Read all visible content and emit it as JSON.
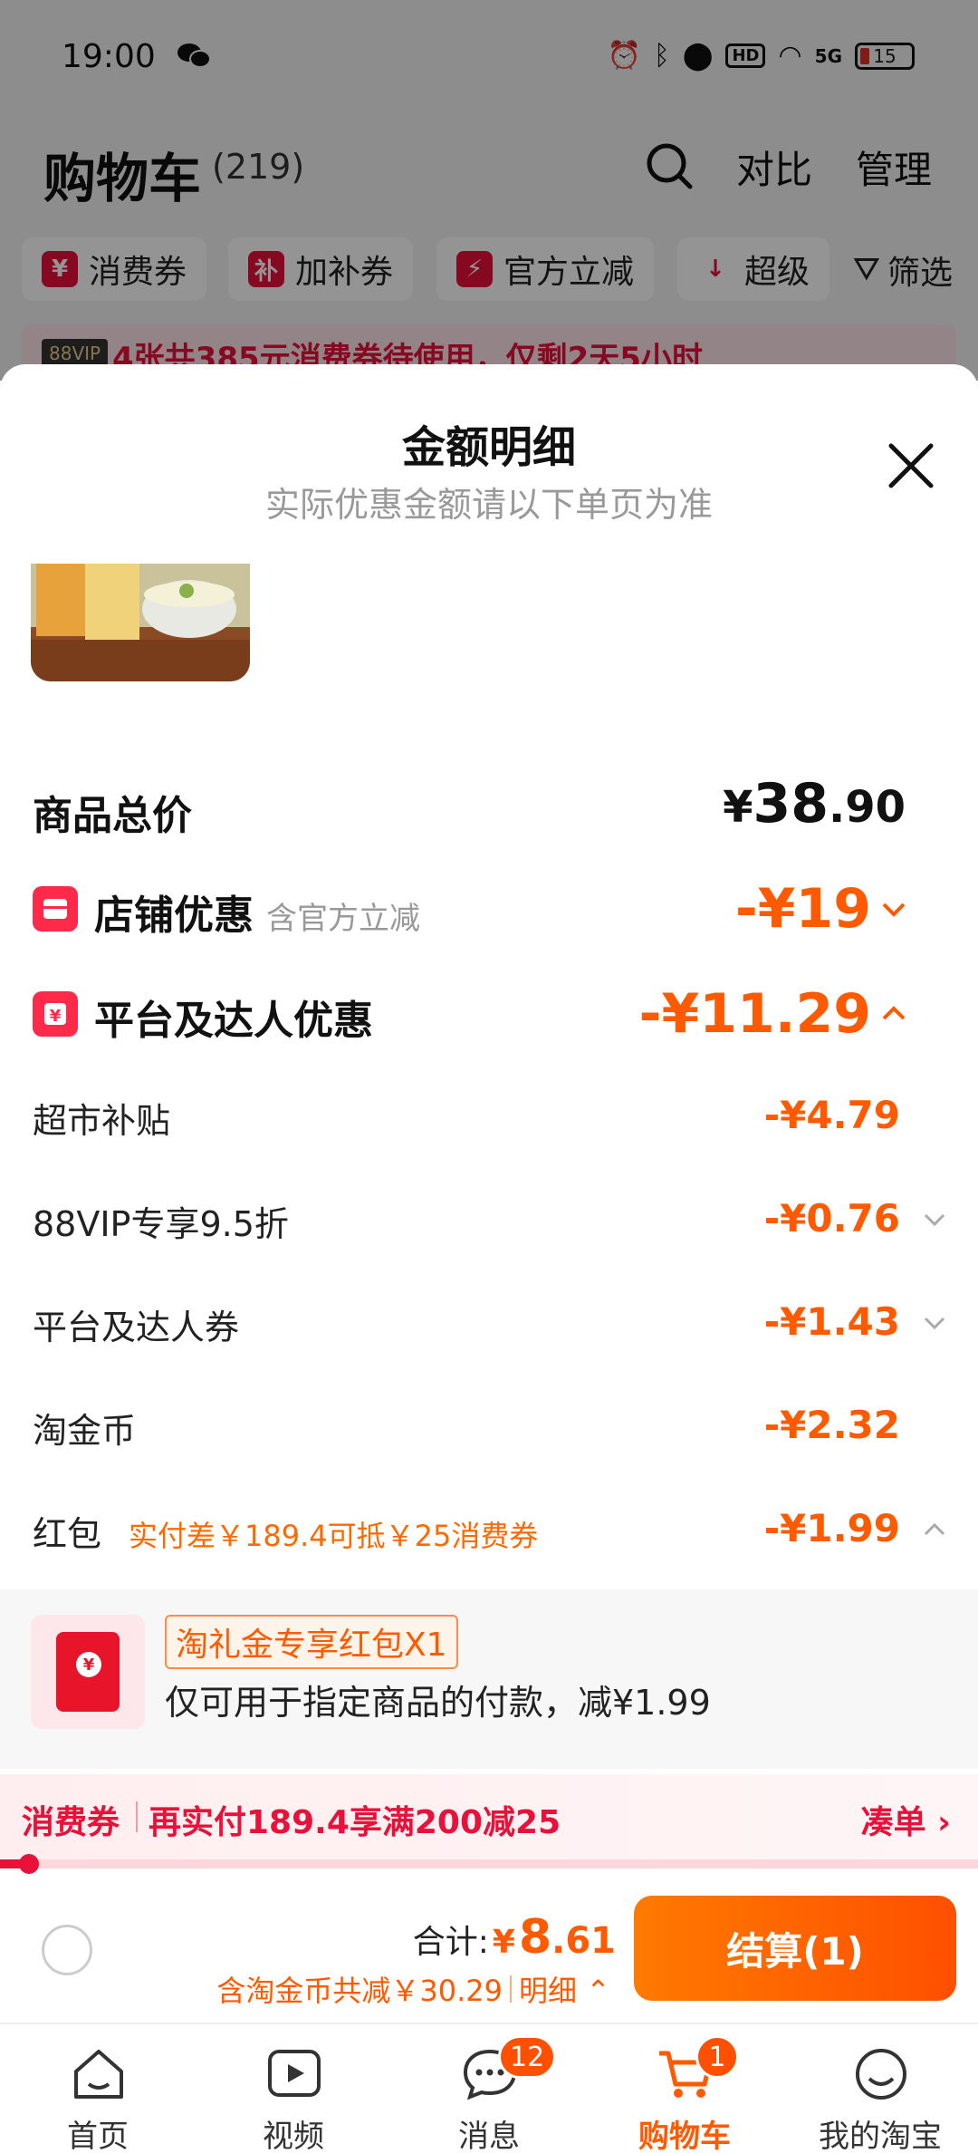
{
  "status_bar": {
    "time": "19:00",
    "battery": "15",
    "network": "5G",
    "hd": "HD"
  },
  "cart_header": {
    "title": "购物车",
    "count": "(219)",
    "compare": "对比",
    "manage": "管理"
  },
  "filters": [
    {
      "icon": "¥",
      "label": "消费券"
    },
    {
      "icon": "补",
      "label": "加补券"
    },
    {
      "icon": "⚡",
      "label": "官方立减"
    },
    {
      "icon": "↓",
      "label": "超级"
    }
  ],
  "filter_button": "筛选",
  "promo_strip": {
    "badge": "88VIP",
    "text": "4张共385元消费券待使用，仅剩2天5小时"
  },
  "sheet": {
    "title": "金额明细",
    "subtitle": "实际优惠金额请以下单页为准",
    "total": {
      "label": "商品总价",
      "yen": "¥",
      "int": "38",
      "dec": ".90"
    },
    "store_discount": {
      "label": "店铺优惠",
      "note": "含官方立减",
      "amount": "-¥19"
    },
    "platform_discount": {
      "label": "平台及达人优惠",
      "amount": "-¥11.29"
    },
    "items": [
      {
        "label": "超市补贴",
        "amount": "-¥4.79"
      },
      {
        "label": "88VIP专享9.5折",
        "amount": "-¥0.76"
      },
      {
        "label": "平台及达人券",
        "amount": "-¥1.43"
      },
      {
        "label": "淘金币",
        "amount": "-¥2.32"
      },
      {
        "label": "红包",
        "hint": "实付差￥189.4可抵￥25消费券",
        "amount": "-¥1.99"
      }
    ],
    "red_packet": {
      "tag": "淘礼金专享红包X1",
      "desc": "仅可用于指定商品的付款，减¥1.99",
      "symbol": "¥"
    }
  },
  "voucher_bar": {
    "label": "消费券",
    "text": "再实付189.4享满200减25",
    "action": "凑单 ›",
    "progress": 0.03
  },
  "checkout": {
    "total_label": "合计:",
    "yen": "¥",
    "total_int": "8",
    "total_dec": ".61",
    "saving": "含淘金币共减￥30.29",
    "detail": "明细 ⌃",
    "pay_button": "结算(1)"
  },
  "tabbar": [
    {
      "label": "首页",
      "icon": "home-icon"
    },
    {
      "label": "视频",
      "icon": "video-icon"
    },
    {
      "label": "消息",
      "icon": "message-icon",
      "badge": "12"
    },
    {
      "label": "购物车",
      "icon": "cart-icon",
      "badge": "1",
      "active": true
    },
    {
      "label": "我的淘宝",
      "icon": "profile-icon"
    }
  ],
  "colors": {
    "accent": "#ff5a00",
    "brand_red": "#e8113a"
  }
}
